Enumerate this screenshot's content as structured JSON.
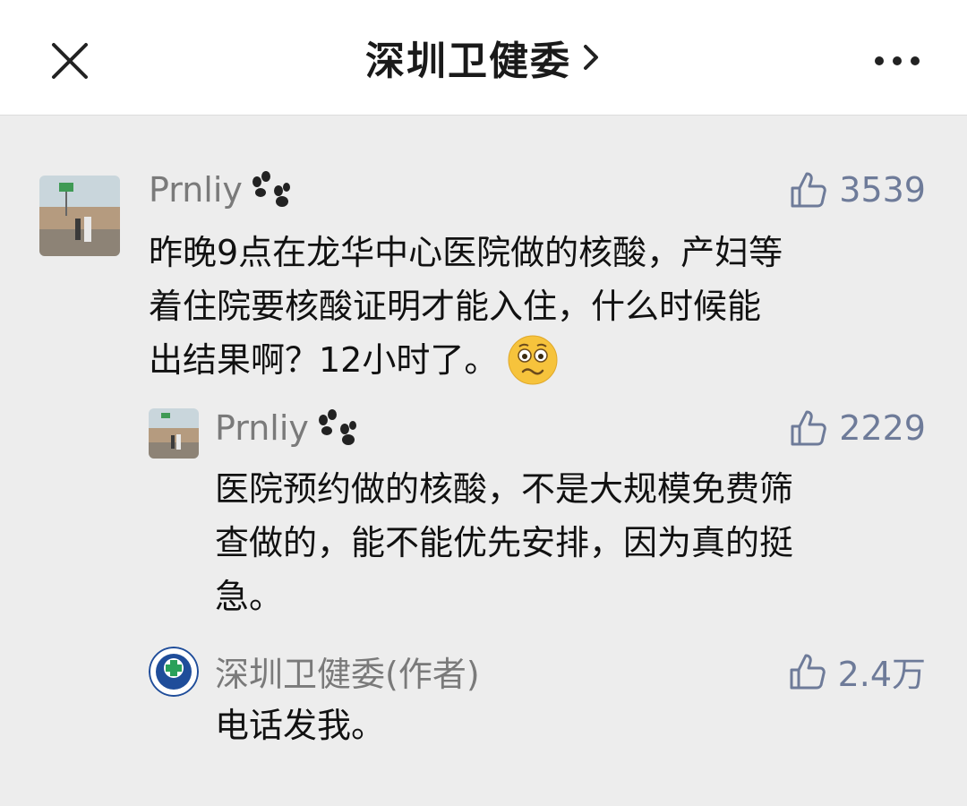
{
  "header": {
    "title": "深圳卫健委",
    "close_icon": "close-icon",
    "chevron_icon": "chevron-right-icon",
    "more_icon": "more-dots-icon"
  },
  "comments": [
    {
      "nickname": "Prnliy",
      "badge_icon": "paw-icon",
      "likes": "3539",
      "like_icon": "thumbs-up-icon",
      "text_lines": [
        "昨晚9点在龙华中心医院做的核酸，产妇等",
        "着住院要核酸证明才能入住，什么时候能",
        "出结果啊？12小时了。"
      ],
      "emoji": "worried-face-emoji"
    },
    {
      "nickname": "Prnliy",
      "badge_icon": "paw-icon",
      "likes": "2229",
      "like_icon": "thumbs-up-icon",
      "text_lines": [
        "医院预约做的核酸，不是大规模免费筛",
        "查做的，能不能优先安排，因为真的挺",
        "急。"
      ]
    },
    {
      "nickname": "深圳卫健委(作者)",
      "likes": "2.4万",
      "like_icon": "thumbs-up-icon",
      "text_lines": [
        "电话发我。"
      ]
    }
  ],
  "colors": {
    "background": "#ededed",
    "header_bg": "#ffffff",
    "nickname": "#7a7a7a",
    "like": "#6e7b99",
    "body_text": "#111111"
  }
}
